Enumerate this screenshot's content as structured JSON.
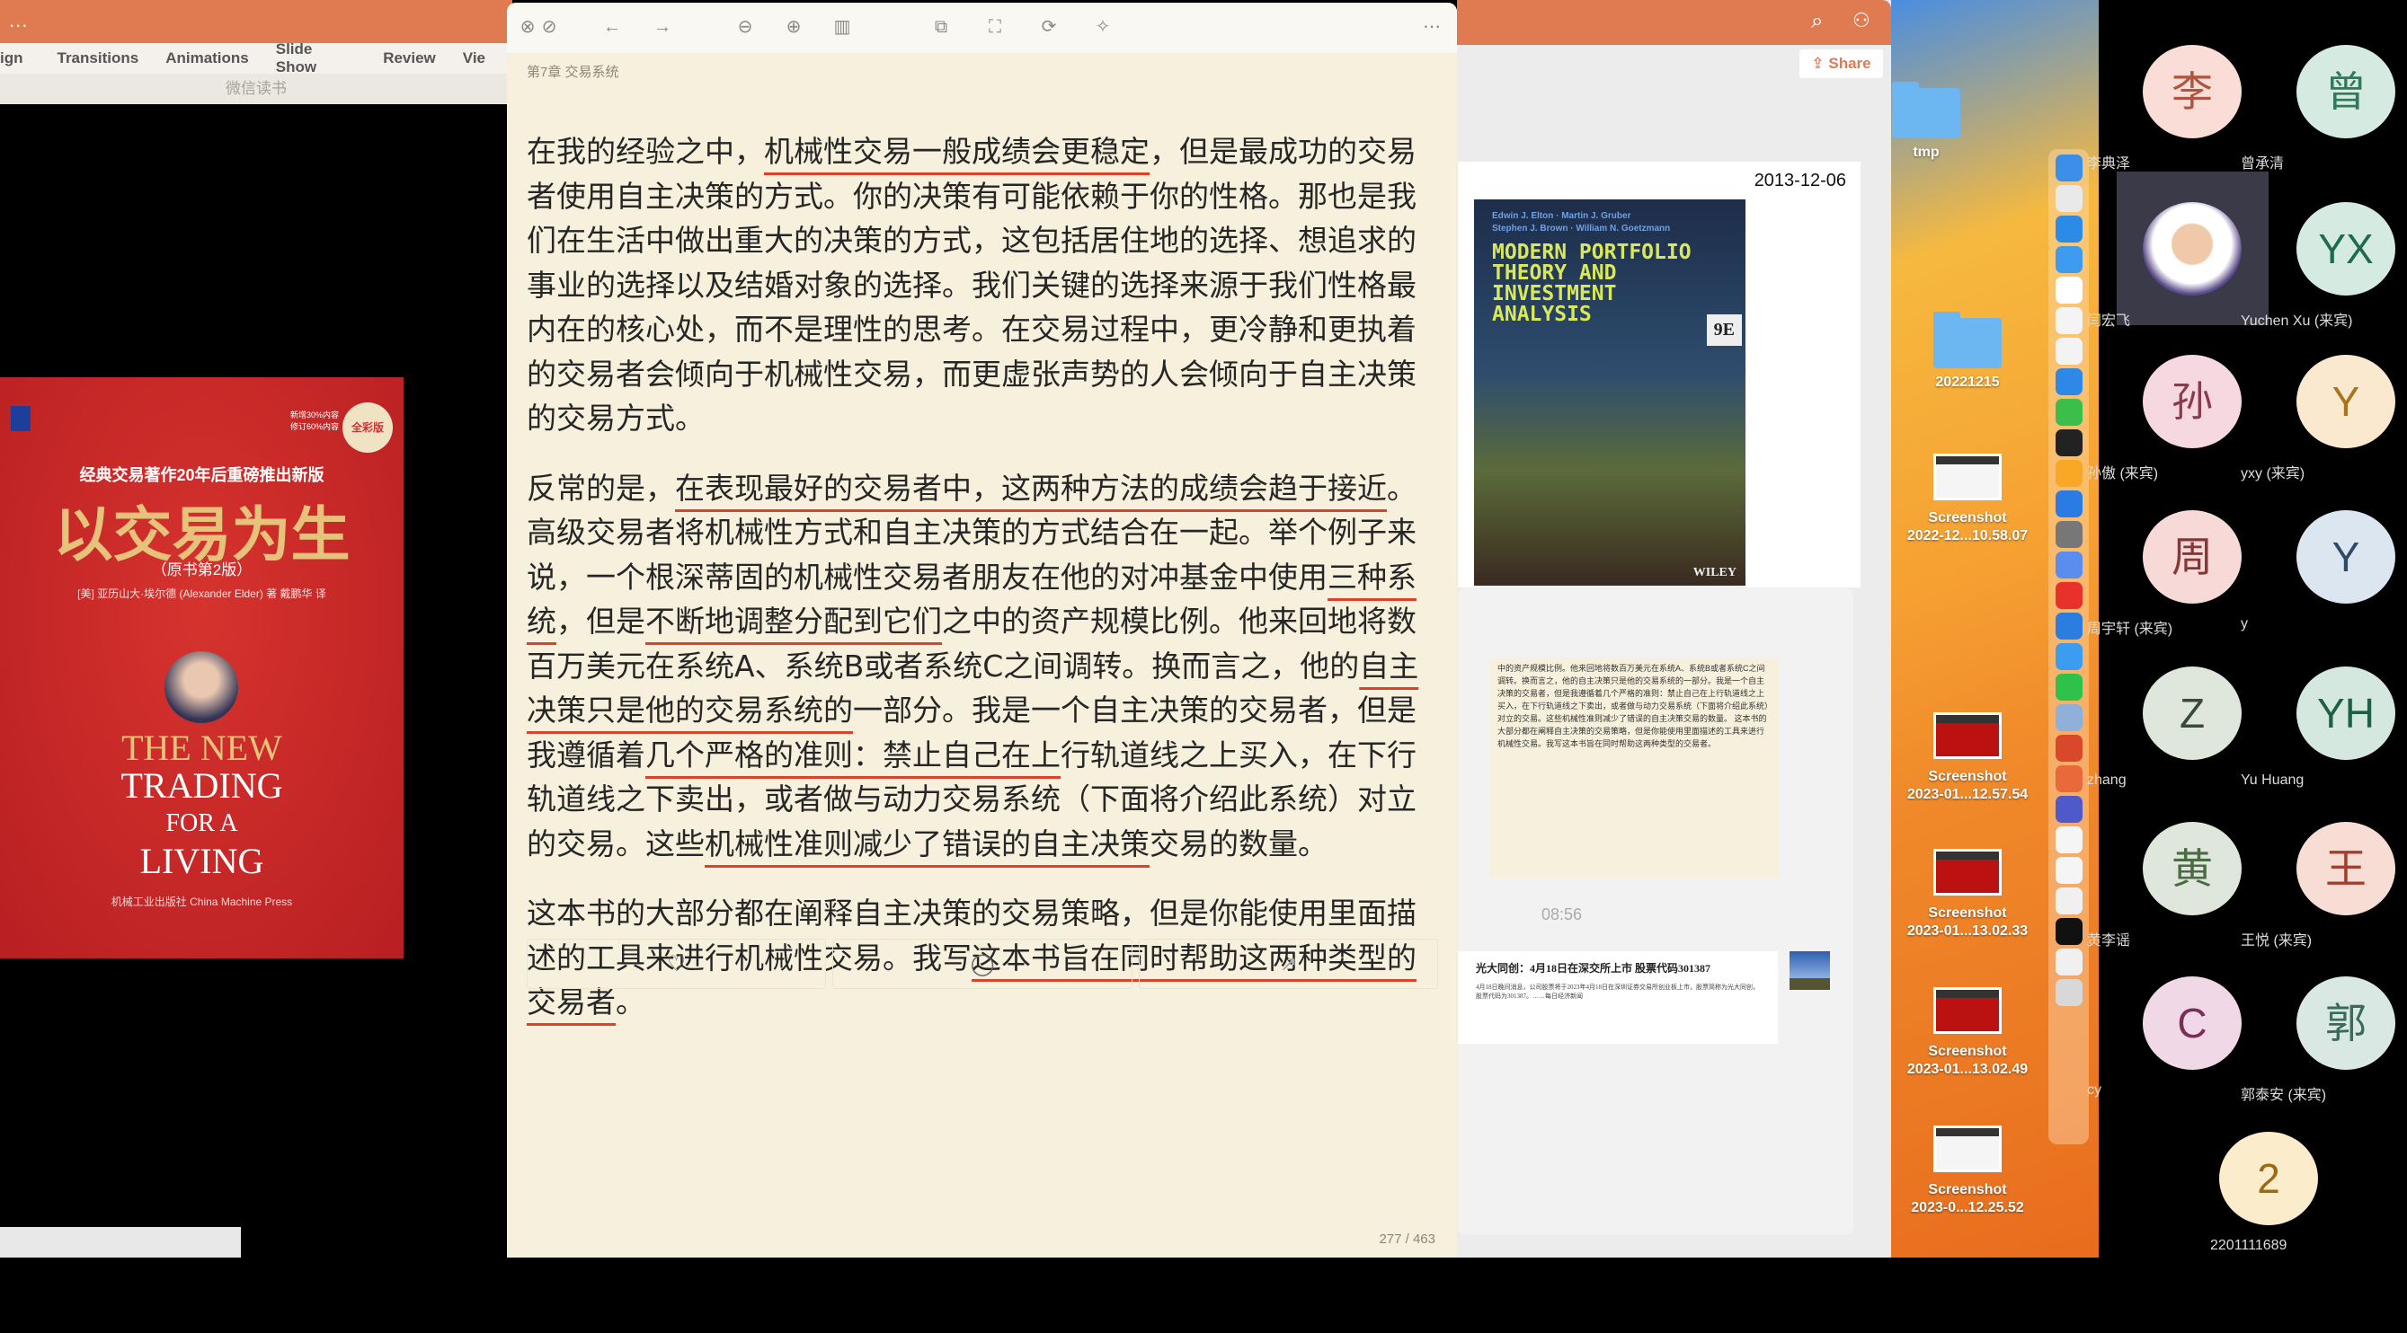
{
  "ppt_left": {
    "menu_dots": "...",
    "ribbon": [
      "ign",
      "Transitions",
      "Animations",
      "Slide Show",
      "Review",
      "Vie"
    ],
    "window_title": "微信读书"
  },
  "cover": {
    "tagline": "经典交易著作20年后重磅推出新版",
    "title_cn": "以交易为生",
    "edition": "（原书第2版）",
    "authors": "[美] 亚历山大·埃尔德 (Alexander Elder) 著  戴鹏华 译",
    "badge": "全彩版",
    "badge_note": "新增30%内容\n修订60%内容",
    "title_en_1": "THE NEW",
    "title_en_2": "TRADING",
    "title_en_3": "FOR A",
    "title_en_4": "LIVING",
    "publisher": "机械工业出版社 China Machine Press"
  },
  "reader": {
    "toolbar_icons": [
      "close-icon",
      "minimize-icon",
      "back-arrow-icon",
      "forward-arrow-icon",
      "zoom-out-icon",
      "zoom-in-icon",
      "columns-icon",
      "copy-icon",
      "screenshot-icon",
      "rotate-icon",
      "magic-wand-icon",
      "more-icon"
    ],
    "chapter": "第7章 交易系统",
    "paragraphs": [
      [
        {
          "text": "在我的经验之中，",
          "ul": false
        },
        {
          "text": "机械性交易一般成绩会更稳定",
          "ul": true
        },
        {
          "text": "，但是最成功的交易者使用自主决策的方式。你的决策有可能依赖于你的性格。那也是我们在生活中做出重大的决策的方式，这包括居住地的选择、想追求的事业的选择以及结婚对象的选择。我们关键的选择来源于我们性格最内在的核心处，而不是理性的思考。在交易过程中，更冷静和更执着的交易者会倾向于机械性交易，而更虚张声势的人会倾向于自主决策的交易方式。",
          "ul": false
        }
      ],
      [
        {
          "text": "反常的是，",
          "ul": false
        },
        {
          "text": "在表现最好的交易者中，这两种方法的成绩会趋于接近",
          "ul": true
        },
        {
          "text": "。高级交易者将机械性方式和自主决策的方式结合在一起。举个例子来说，一个根深蒂固的机械性交易者朋友在他的对冲基金中使用",
          "ul": false
        },
        {
          "text": "三种系统",
          "ul": true
        },
        {
          "text": "，但是",
          "ul": false
        },
        {
          "text": "不断地调整分配到它们",
          "ul": true
        },
        {
          "text": "之中的资产规模比例。他来回地将数百万美元在系统A、系统B或者系统C之间调转。换而言之，他的",
          "ul": false
        },
        {
          "text": "自主决策只是他的交易系统的",
          "ul": true
        },
        {
          "text": "一部分。我是一个自主决策的交易者，但是我遵循着",
          "ul": false
        },
        {
          "text": "几个严格的准则：禁止自己在上",
          "ul": true
        },
        {
          "text": "行轨道线之上买入，在下行轨道线之下卖出，或者做与动力交易系统（下面将介绍此系统）对立的交易。这些",
          "ul": false
        },
        {
          "text": "机械性准则减少了错误的自主决策",
          "ul": true
        },
        {
          "text": "交易的数量。",
          "ul": false
        }
      ],
      [
        {
          "text": "这本书的大部分都在阐释自主决策的交易策略，但是你能使用里面描述的工具来进行机械性交易。我写",
          "ul": false
        },
        {
          "text": "这本书旨在同时帮助这两种类型的交易者",
          "ul": true
        },
        {
          "text": "。",
          "ul": false
        }
      ]
    ],
    "actions": [
      "heart-icon",
      "comment-icon",
      "share-icon"
    ],
    "page_indicator": "277 / 463",
    "underline_color": "#d8432a",
    "background": "#f6f0dc"
  },
  "ppt_right": {
    "share_label": "Share",
    "slide_date": "2013-12-06",
    "book": {
      "authors": "Edwin J. Elton · Martin J. Gruber\nStephen J. Brown · William N. Goetzmann",
      "title": "MODERN PORTFOLIO\nTHEORY AND\nINVESTMENT\nANALYSIS",
      "edition": "9E",
      "publisher": "WILEY"
    },
    "mini_text": "中的资产规模比例。他来回地将数百万美元在系统A、系统B或者系统C之间调转。换而言之，他的自主决策只是他的交易系统的一部分。我是一个自主决策的交易者，但是我遵循着几个严格的准则：禁止自己在上行轨道线之上买入，在下行轨道线之下卖出，或者做与动力交易系统（下面将介绍此系统）对立的交易。这些机械性准则减少了错误的自主决策交易的数量。 这本书的大部分都在阐释自主决策的交易策略，但是你能使用里面描述的工具来进行机械性交易。我写这本书旨在同时帮助这两种类型的交易者。",
    "time": "08:56",
    "news_headline": "光大同创：4月18日在深交所上市 股票代码301387",
    "news_body": "4月18日晚间消息，公司股票将于2023年4月18日在深圳证券交易所创业板上市，股票简称为光大同创，股票代码为301387。……每日经济新闻"
  },
  "desktop": {
    "items": [
      {
        "label": "tmp",
        "kind": "folder"
      },
      {
        "label": "20221215",
        "kind": "folder"
      },
      {
        "label": "Screenshot\n2022-12...10.58.07",
        "kind": "shot"
      },
      {
        "label": "Screenshot\n2023-01...12.57.54",
        "kind": "shot-red"
      },
      {
        "label": "Screenshot\n2023-01...13.02.33",
        "kind": "shot-red"
      },
      {
        "label": "Screenshot\n2023-01...13.02.49",
        "kind": "shot-red"
      },
      {
        "label": "Screenshot\n2023-0...12.25.52",
        "kind": "shot-white"
      }
    ],
    "dock": [
      "#3b8fe8",
      "#e9e9e9",
      "#2b8be6",
      "#3d9bf0",
      "#ffffff",
      "#f4f4f4",
      "#f3f3f3",
      "#2e88e8",
      "#3cbf4a",
      "#222222",
      "#f7a826",
      "#2a7be4",
      "#777777",
      "#5b8cf0",
      "#e8312a",
      "#2b7ee0",
      "#3b9cf0",
      "#2fc24a",
      "#8fb0d8",
      "#d9482a",
      "#e86a3a",
      "#5059c9",
      "#f5f5f5",
      "#f5f5f5",
      "#f0f0f0",
      "#111111",
      "#f0f0f0",
      "#d8d8d8"
    ]
  },
  "participants": [
    {
      "initial": "李",
      "name": "李典泽",
      "bg": "#f9ddd6",
      "fg": "#b0543e"
    },
    {
      "initial": "曾",
      "name": "曾承清",
      "bg": "#d5ebe2",
      "fg": "#2e7a5a"
    },
    {
      "initial": "",
      "name": "闫宏飞",
      "bg": "#ffffff",
      "fg": "#333333",
      "photo": true,
      "active": true
    },
    {
      "initial": "YX",
      "name": "Yuchen Xu (来宾)",
      "bg": "#d5ebe2",
      "fg": "#1f6b50"
    },
    {
      "initial": "孙",
      "name": "孙傲 (来宾)",
      "bg": "#f6d9e0",
      "fg": "#8a3a4e"
    },
    {
      "initial": "Y",
      "name": "yxy (来宾)",
      "bg": "#fbe9cf",
      "fg": "#a8741c"
    },
    {
      "initial": "周",
      "name": "周宇轩 (来宾)",
      "bg": "#f7d9d8",
      "fg": "#8a3535"
    },
    {
      "initial": "Y",
      "name": "y",
      "bg": "#dbe6f0",
      "fg": "#2f4a63"
    },
    {
      "initial": "Z",
      "name": "zhang",
      "bg": "#dfe6dc",
      "fg": "#3a4a3a"
    },
    {
      "initial": "YH",
      "name": "Yu Huang",
      "bg": "#d5e8e0",
      "fg": "#1f5f44"
    },
    {
      "initial": "黄",
      "name": "黄李谣",
      "bg": "#dfe6dc",
      "fg": "#4b6b45"
    },
    {
      "initial": "王",
      "name": "王悦 (来宾)",
      "bg": "#f8ddd5",
      "fg": "#a04030"
    },
    {
      "initial": "C",
      "name": "cy",
      "bg": "#f0d8e6",
      "fg": "#7a2f55"
    },
    {
      "initial": "郭",
      "name": "郭泰安 (来宾)",
      "bg": "#d9e8e2",
      "fg": "#3a6a5a"
    },
    {
      "initial": "2",
      "name": "2201111689",
      "bg": "#fbeccb",
      "fg": "#9a6a14"
    }
  ]
}
